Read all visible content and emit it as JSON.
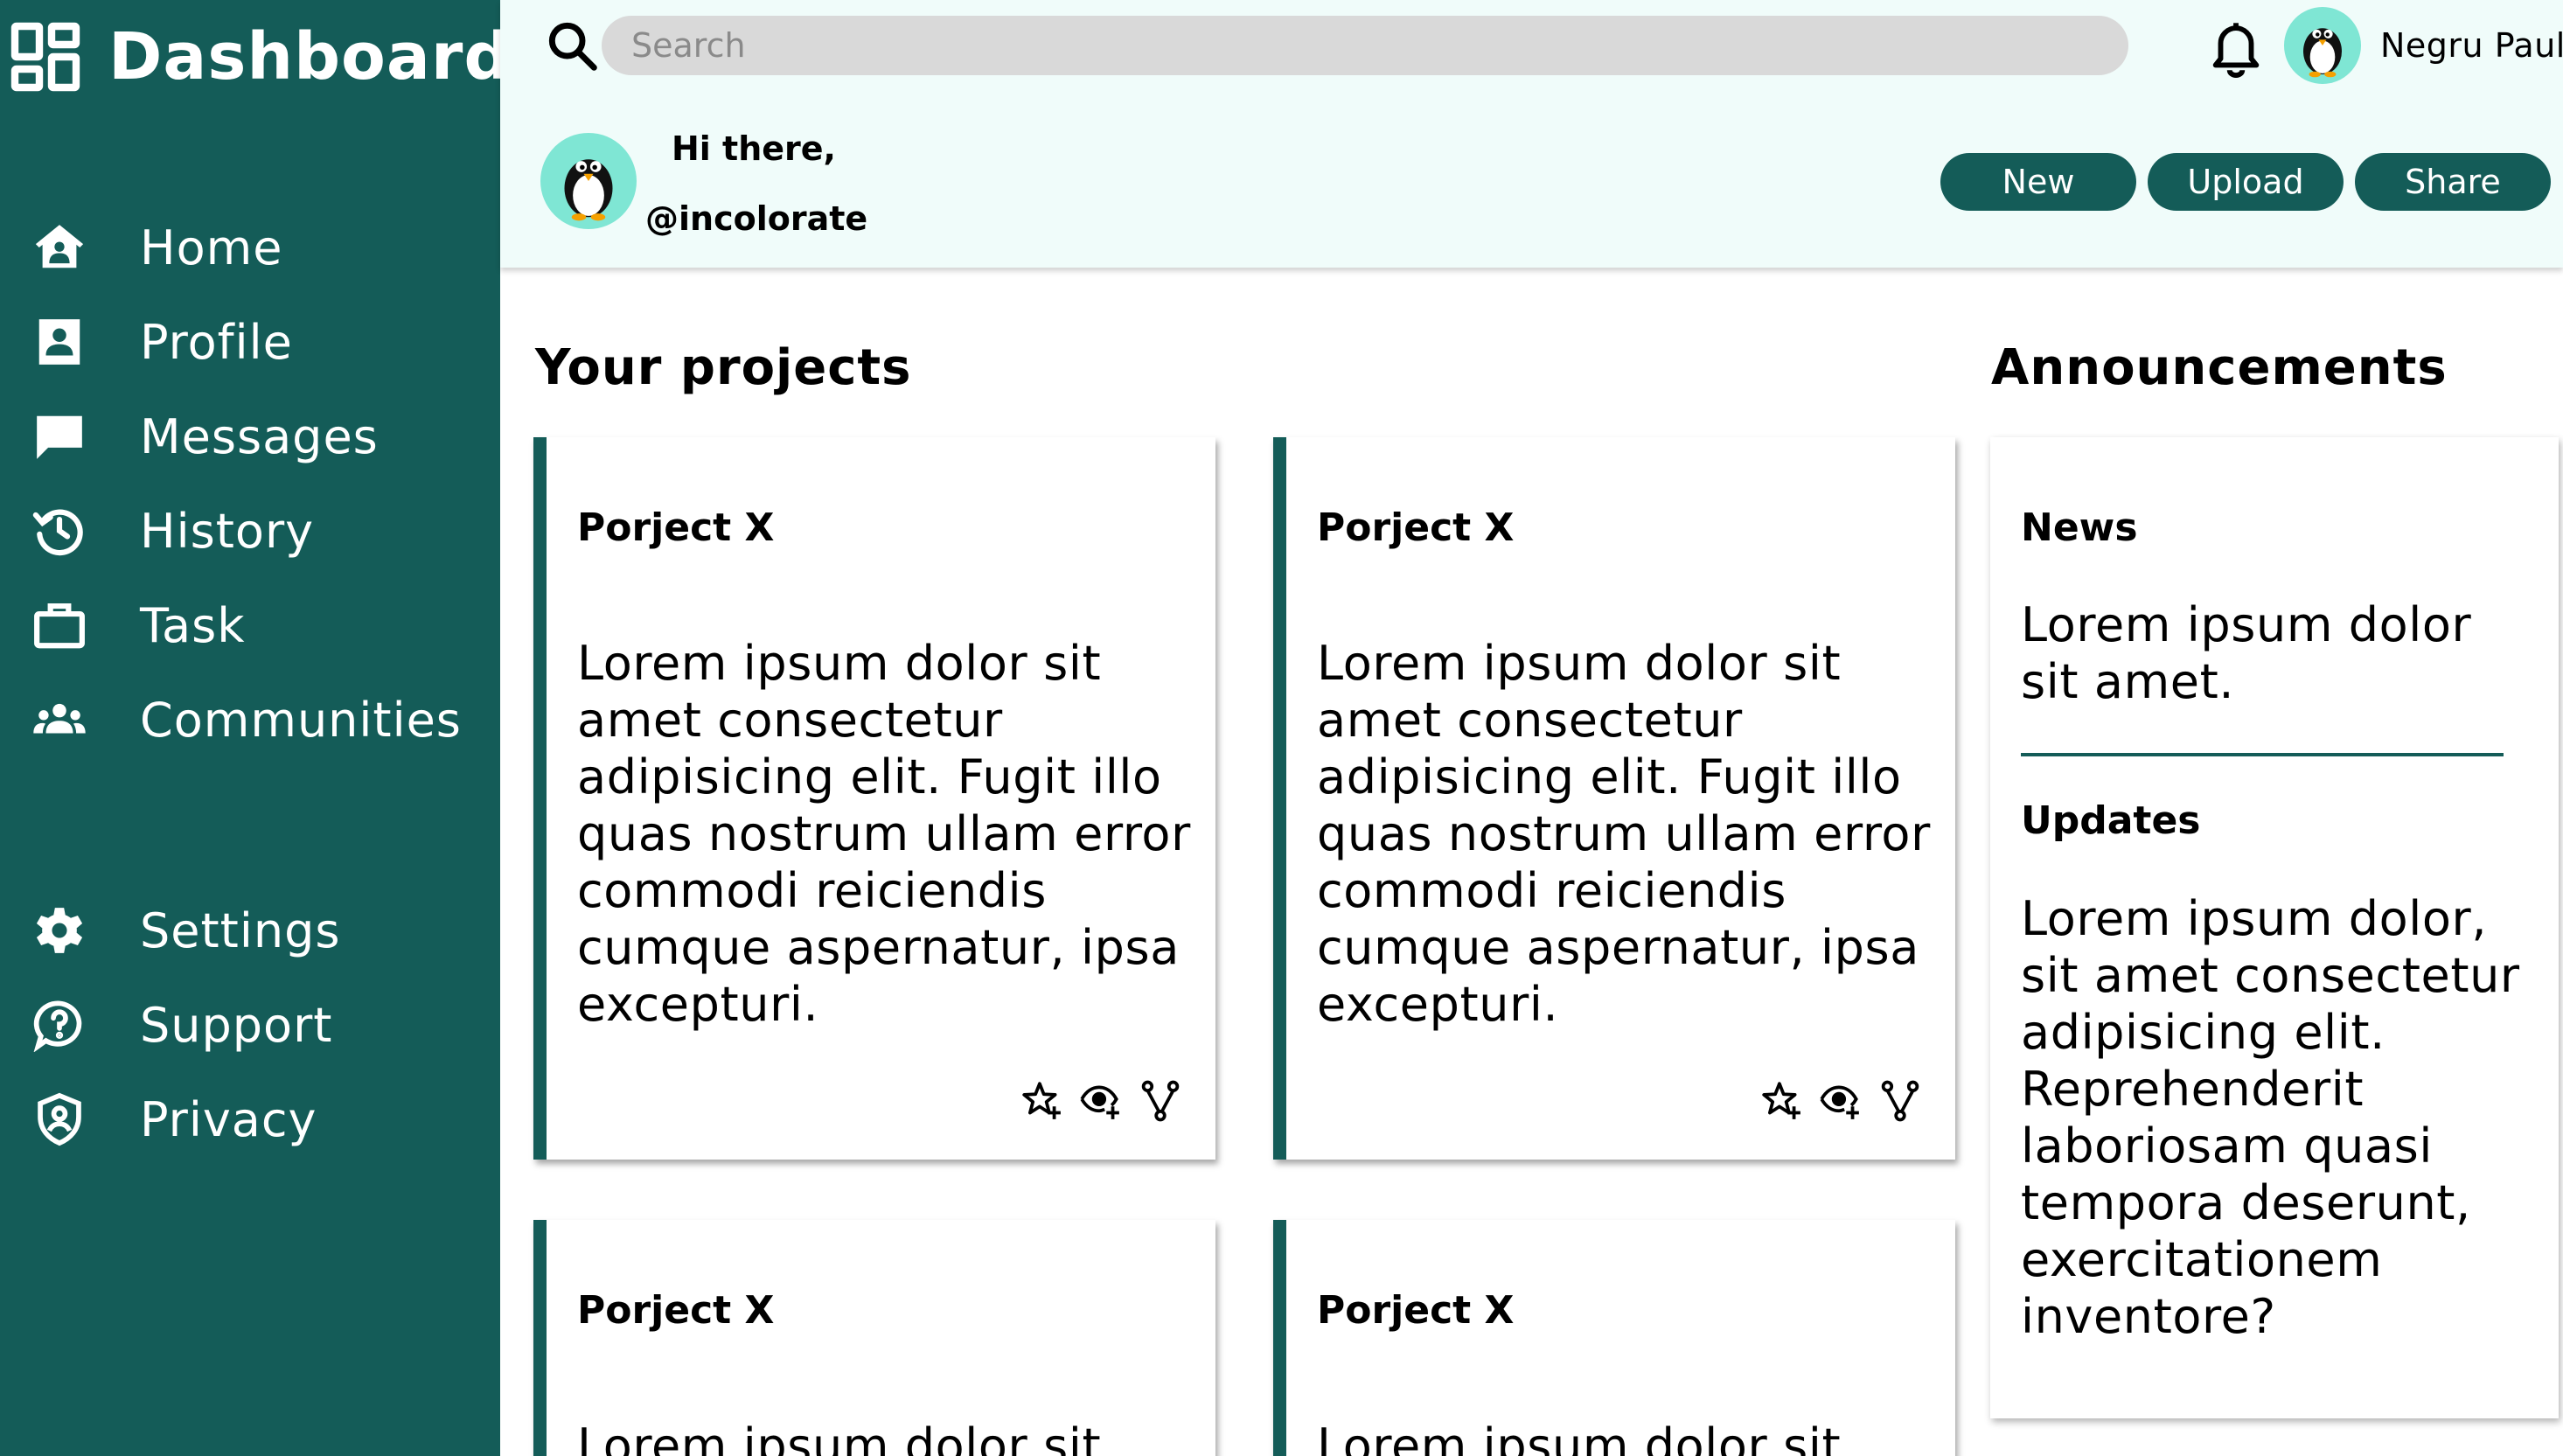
{
  "brand": {
    "title": "Dashboard",
    "icon": "dashboard-grid-icon"
  },
  "sidebar": {
    "items": [
      {
        "label": "Home",
        "icon": "home-icon"
      },
      {
        "label": "Profile",
        "icon": "profile-card-icon"
      },
      {
        "label": "Messages",
        "icon": "message-icon"
      },
      {
        "label": "History",
        "icon": "history-icon"
      },
      {
        "label": "Task",
        "icon": "briefcase-icon"
      },
      {
        "label": "Communities",
        "icon": "people-icon"
      },
      {
        "label": "Settings",
        "icon": "gear-icon"
      },
      {
        "label": "Support",
        "icon": "help-bubble-icon"
      },
      {
        "label": "Privacy",
        "icon": "shield-icon"
      }
    ]
  },
  "header": {
    "search": {
      "placeholder": "Search"
    },
    "user_name": "Negru Paul",
    "greeting": "Hi there,",
    "handle": "@incolorate",
    "buttons": {
      "new": "New",
      "upload": "Upload",
      "share": "Share"
    }
  },
  "projects": {
    "title": "Your projects",
    "cards": [
      {
        "title": "Porject X",
        "body": "Lorem ipsum dolor sit amet consectetur adipisicing elit. Fugit illo quas nostrum ullam error commodi reiciendis cumque aspernatur, ipsa excepturi."
      },
      {
        "title": "Porject X",
        "body": "Lorem ipsum dolor sit amet consectetur adipisicing elit. Fugit illo quas nostrum ullam error commodi reiciendis cumque aspernatur, ipsa excepturi."
      },
      {
        "title": "Porject X",
        "body": "Lorem ipsum dolor sit"
      },
      {
        "title": "Porject X",
        "body": "Lorem ipsum dolor sit"
      }
    ]
  },
  "announcements": {
    "title": "Announcements",
    "items": [
      {
        "title": "News",
        "body": "Lorem ipsum dolor sit amet."
      },
      {
        "title": "Updates",
        "body": "Lorem ipsum dolor, sit amet consectetur adipisicing elit. Reprehenderit laboriosam quasi tempora deserunt, exercitationem inventore?"
      }
    ]
  },
  "colors": {
    "primary": "#145c58",
    "header_bg": "#f0fcfa",
    "search_bg": "#d9d9d9",
    "avatar_bg": "#7fe6d4"
  }
}
